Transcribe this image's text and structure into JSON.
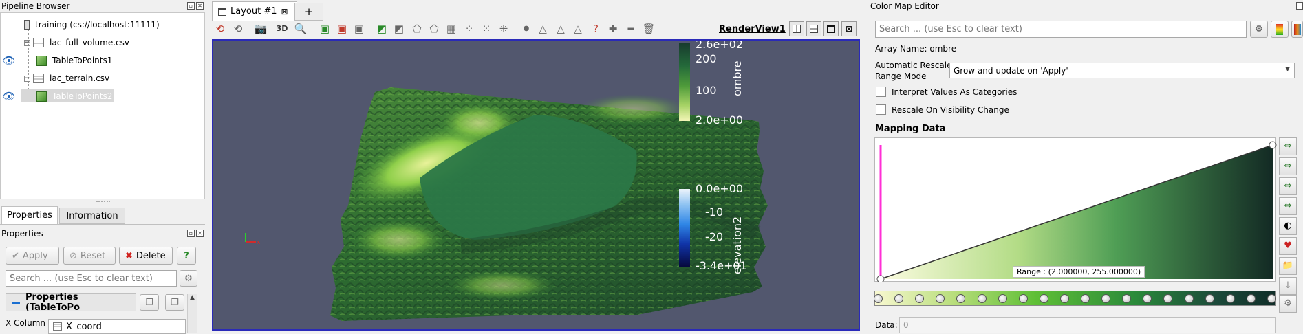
{
  "pipeline": {
    "title": "Pipeline Browser",
    "items": [
      {
        "label": "training (cs://localhost:11111)"
      },
      {
        "label": "lac_full_volume.csv"
      },
      {
        "label": "TableToPoints1"
      },
      {
        "label": "lac_terrain.csv"
      },
      {
        "label": "TableToPoints2"
      }
    ]
  },
  "tabs": {
    "properties": "Properties",
    "information": "Information"
  },
  "properties": {
    "title": "Properties",
    "apply": "Apply",
    "reset": "Reset",
    "delete": "Delete",
    "help": "?",
    "search_placeholder": "Search ... (use Esc to clear text)",
    "section": "Properties (TableToPo",
    "x_column_label": "X Column",
    "x_column_value": "X_coord"
  },
  "layout_tab": {
    "label": "Layout #1",
    "close": "⊠",
    "add": "+"
  },
  "view": {
    "name": "RenderView1",
    "btn_3d": "3D",
    "background_color": "#52576e",
    "colorbar_ombre": {
      "title": "ombre",
      "ticks": [
        "2.6e+02",
        "200",
        "100",
        "2.0e+00"
      ]
    },
    "colorbar_elevation": {
      "title": "elevation2",
      "ticks": [
        "0.0e+00",
        "-10",
        "-20",
        "-3.4e+01"
      ]
    }
  },
  "colormap_editor": {
    "title": "Color Map Editor",
    "search_placeholder": "Search ... (use Esc to clear text)",
    "array_name": "Array Name: ombre",
    "rescale_label_1": "Automatic Rescale",
    "rescale_label_2": "Range Mode",
    "rescale_value": "Grow and update on 'Apply'",
    "interpret_categories": "Interpret Values As Categories",
    "rescale_visibility": "Rescale On Visibility Change",
    "mapping_data": "Mapping Data",
    "range_tooltip": "Range : (2.000000, 255.000000)",
    "data_label": "Data:",
    "data_value": "0"
  }
}
